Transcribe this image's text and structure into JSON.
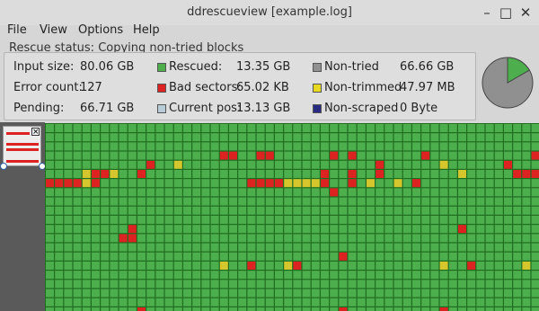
{
  "window": {
    "title": "ddrescueview [example.log]",
    "minimize_glyph": "–",
    "maximize_glyph": "□",
    "close_glyph": "✕"
  },
  "menu": [
    "File",
    "View",
    "Options",
    "Help"
  ],
  "status": {
    "label": "Rescue status:",
    "value": "Copying non-tried blocks"
  },
  "stats": {
    "input_size": {
      "label": "Input size:",
      "value": "80.06 GB"
    },
    "error_count": {
      "label": "Error count:",
      "value": "127"
    },
    "pending": {
      "label": "Pending:",
      "value": "66.71 GB"
    },
    "rescued": {
      "label": "Rescued:",
      "value": "13.35 GB",
      "color": "#4cae4c"
    },
    "bad_sectors": {
      "label": "Bad sectors:",
      "value": "65.02 KB",
      "color": "#dd2222"
    },
    "current_pos": {
      "label": "Current pos:",
      "value": "13.13 GB",
      "color": "#b8ccd8"
    },
    "non_tried": {
      "label": "Non-tried",
      "value": "66.66 GB",
      "color": "#909090"
    },
    "non_trimmed": {
      "label": "Non-trimmed",
      "value": "47.97 MB",
      "color": "#e8d820"
    },
    "non_scraped": {
      "label": "Non-scraped",
      "value": "0 Byte",
      "color": "#2a2a80"
    }
  },
  "pie": {
    "rescued_fraction": 0.167,
    "rescued_color": "#4cae4c",
    "rest_color": "#909090"
  },
  "grid": {
    "rescued_color": "#4cae4c",
    "bad_color": "#dd2222",
    "trimmed_color": "#d4c62c",
    "marks": [
      {
        "row": 3,
        "col": 19,
        "t": "r"
      },
      {
        "row": 3,
        "col": 20,
        "t": "r"
      },
      {
        "row": 3,
        "col": 23,
        "t": "r"
      },
      {
        "row": 3,
        "col": 24,
        "t": "r"
      },
      {
        "row": 3,
        "col": 31,
        "t": "r"
      },
      {
        "row": 3,
        "col": 33,
        "t": "r"
      },
      {
        "row": 3,
        "col": 41,
        "t": "r"
      },
      {
        "row": 3,
        "col": 53,
        "t": "r"
      },
      {
        "row": 4,
        "col": 11,
        "t": "r"
      },
      {
        "row": 4,
        "col": 14,
        "t": "y"
      },
      {
        "row": 4,
        "col": 43,
        "t": "y"
      },
      {
        "row": 4,
        "col": 50,
        "t": "r"
      },
      {
        "row": 4,
        "col": 36,
        "t": "r"
      },
      {
        "row": 5,
        "col": 4,
        "t": "y"
      },
      {
        "row": 5,
        "col": 5,
        "t": "r"
      },
      {
        "row": 5,
        "col": 6,
        "t": "r"
      },
      {
        "row": 5,
        "col": 7,
        "t": "y"
      },
      {
        "row": 5,
        "col": 10,
        "t": "r"
      },
      {
        "row": 5,
        "col": 30,
        "t": "r"
      },
      {
        "row": 5,
        "col": 33,
        "t": "r"
      },
      {
        "row": 5,
        "col": 36,
        "t": "r"
      },
      {
        "row": 5,
        "col": 45,
        "t": "y"
      },
      {
        "row": 5,
        "col": 51,
        "t": "r"
      },
      {
        "row": 5,
        "col": 52,
        "t": "r"
      },
      {
        "row": 5,
        "col": 53,
        "t": "r"
      },
      {
        "row": 6,
        "col": 0,
        "t": "r"
      },
      {
        "row": 6,
        "col": 1,
        "t": "r"
      },
      {
        "row": 6,
        "col": 2,
        "t": "r"
      },
      {
        "row": 6,
        "col": 3,
        "t": "r"
      },
      {
        "row": 6,
        "col": 4,
        "t": "y"
      },
      {
        "row": 6,
        "col": 5,
        "t": "r"
      },
      {
        "row": 6,
        "col": 22,
        "t": "r"
      },
      {
        "row": 6,
        "col": 23,
        "t": "r"
      },
      {
        "row": 6,
        "col": 24,
        "t": "r"
      },
      {
        "row": 6,
        "col": 25,
        "t": "r"
      },
      {
        "row": 6,
        "col": 26,
        "t": "y"
      },
      {
        "row": 6,
        "col": 27,
        "t": "y"
      },
      {
        "row": 6,
        "col": 28,
        "t": "y"
      },
      {
        "row": 6,
        "col": 29,
        "t": "y"
      },
      {
        "row": 6,
        "col": 30,
        "t": "r"
      },
      {
        "row": 6,
        "col": 33,
        "t": "r"
      },
      {
        "row": 6,
        "col": 35,
        "t": "y"
      },
      {
        "row": 6,
        "col": 38,
        "t": "y"
      },
      {
        "row": 6,
        "col": 40,
        "t": "r"
      },
      {
        "row": 7,
        "col": 31,
        "t": "r"
      },
      {
        "row": 11,
        "col": 9,
        "t": "r"
      },
      {
        "row": 11,
        "col": 45,
        "t": "r"
      },
      {
        "row": 12,
        "col": 8,
        "t": "r"
      },
      {
        "row": 12,
        "col": 9,
        "t": "r"
      },
      {
        "row": 14,
        "col": 32,
        "t": "r"
      },
      {
        "row": 15,
        "col": 19,
        "t": "y"
      },
      {
        "row": 15,
        "col": 22,
        "t": "r"
      },
      {
        "row": 15,
        "col": 26,
        "t": "y"
      },
      {
        "row": 15,
        "col": 27,
        "t": "r"
      },
      {
        "row": 15,
        "col": 43,
        "t": "y"
      },
      {
        "row": 15,
        "col": 46,
        "t": "r"
      },
      {
        "row": 15,
        "col": 52,
        "t": "y"
      },
      {
        "row": 20,
        "col": 10,
        "t": "r"
      },
      {
        "row": 20,
        "col": 32,
        "t": "r"
      },
      {
        "row": 20,
        "col": 43,
        "t": "r"
      }
    ]
  }
}
